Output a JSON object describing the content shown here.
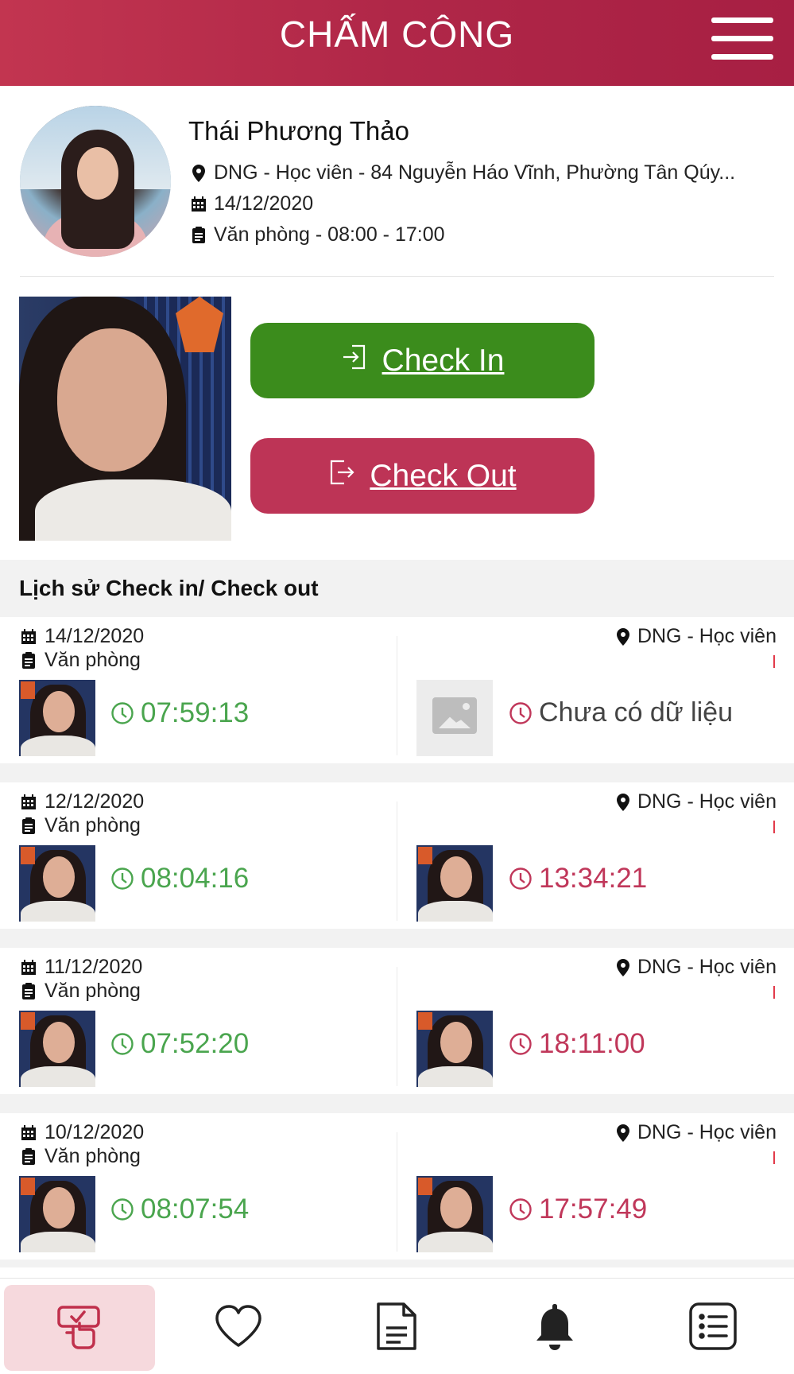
{
  "header": {
    "title": "CHẤM CÔNG"
  },
  "profile": {
    "name": "Thái Phương Thảo",
    "location": "DNG - Học viên - 84 Nguyễn Háo Vĩnh, Phường Tân Qúy...",
    "date": "14/12/2020",
    "shift": "Văn phòng - 08:00 - 17:00"
  },
  "actions": {
    "check_in": "Check In",
    "check_out": "Check Out"
  },
  "history": {
    "title": "Lịch sử Check in/ Check out",
    "records": [
      {
        "date": "14/12/2020",
        "place": "Văn phòng",
        "location": "DNG - Học viên",
        "check_in": "07:59:13",
        "check_out": "Chưa có dữ liệu"
      },
      {
        "date": "12/12/2020",
        "place": "Văn phòng",
        "location": "DNG - Học viên",
        "check_in": "08:04:16",
        "check_out": "13:34:21"
      },
      {
        "date": "11/12/2020",
        "place": "Văn phòng",
        "location": "DNG - Học viên",
        "check_in": "07:52:20",
        "check_out": "18:11:00"
      },
      {
        "date": "10/12/2020",
        "place": "Văn phòng",
        "location": "DNG - Học viên",
        "check_in": "08:07:54",
        "check_out": "17:57:49"
      }
    ]
  },
  "nav": {
    "items": [
      "attendance-icon",
      "heart-icon",
      "document-icon",
      "bell-icon",
      "list-icon"
    ],
    "active": "attendance-icon"
  },
  "colors": {
    "brand": "#b02748",
    "check_in": "#3b8c1c",
    "check_out": "#bd3456",
    "time_in": "#4aa54e",
    "time_out": "#c0375a"
  }
}
